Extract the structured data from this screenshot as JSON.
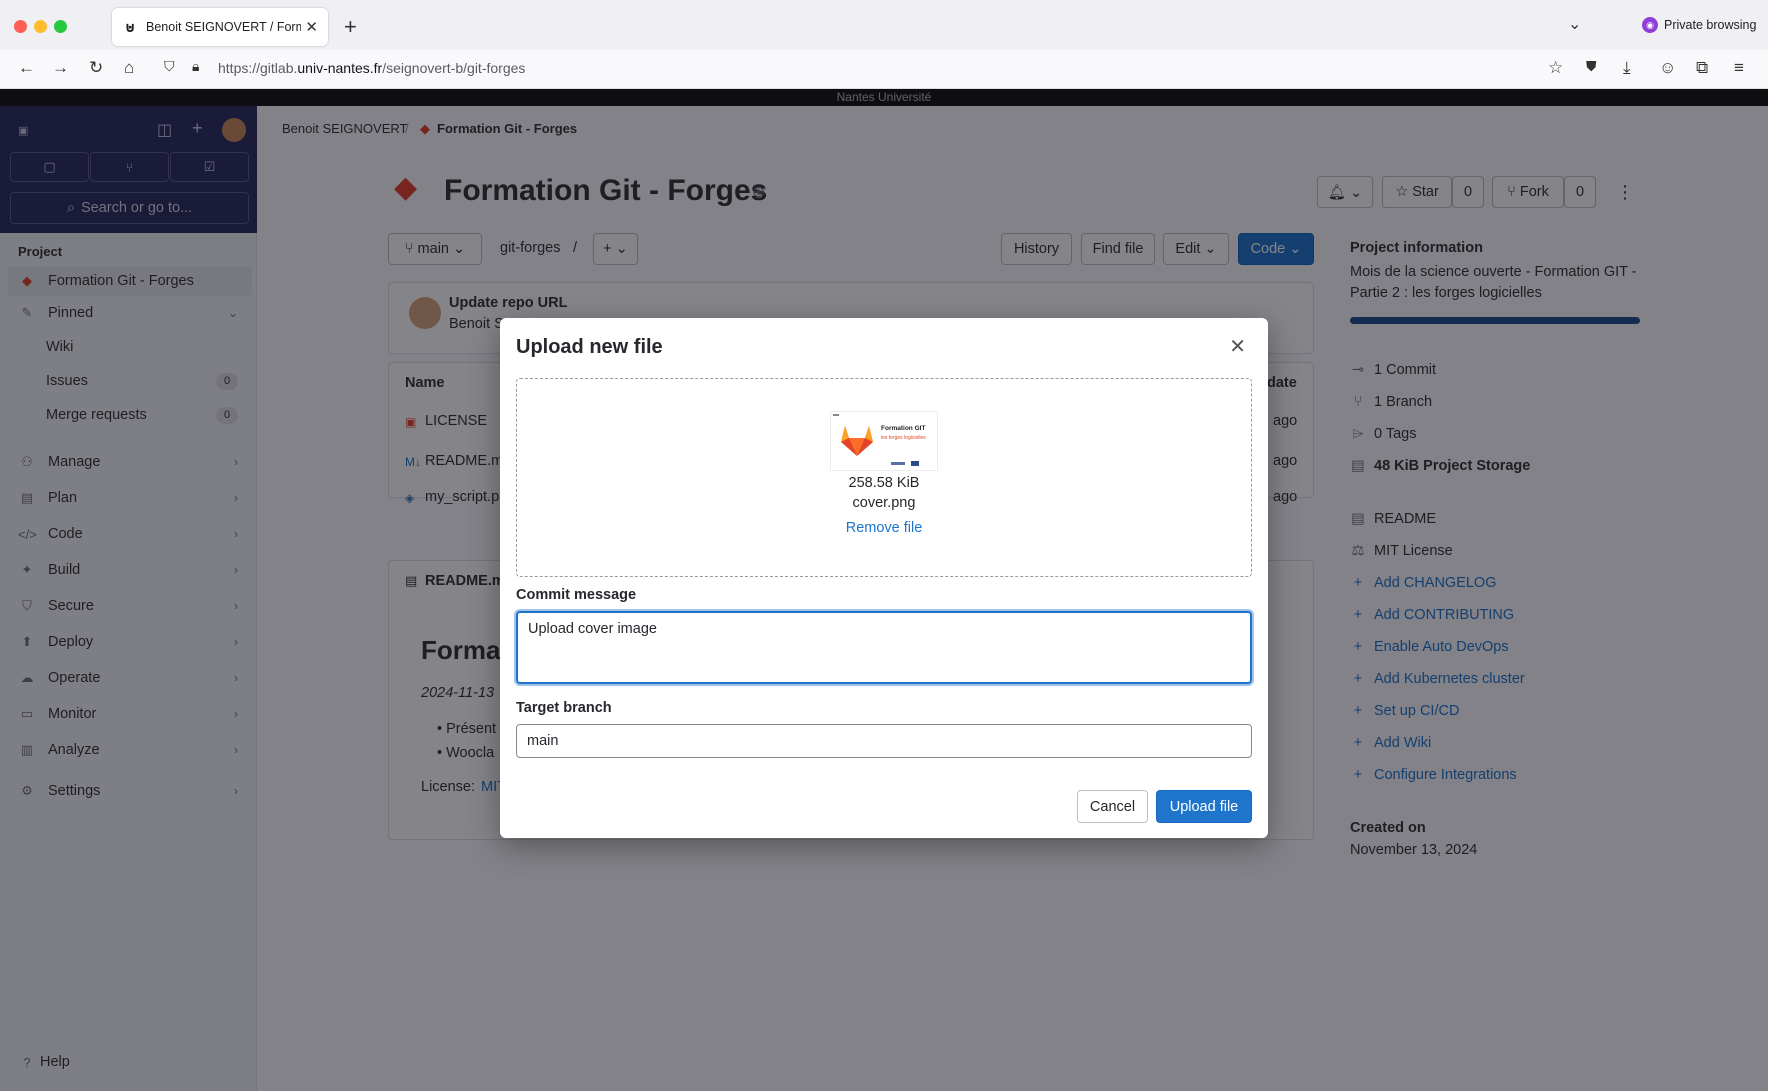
{
  "browser": {
    "tab_title": "Benoit SEIGNOVERT / Formation",
    "url_prefix": "https://gitlab.",
    "url_domain": "univ-nantes.fr",
    "url_path": "/seignovert-b/git-forges",
    "private_label": "Private browsing"
  },
  "banner": "Nantes Université",
  "sidebar": {
    "search": "Search or go to...",
    "section": "Project",
    "project_name": "Formation Git - Forges",
    "pinned": "Pinned",
    "pinned_items": [
      {
        "label": "Wiki"
      },
      {
        "label": "Issues",
        "count": "0"
      },
      {
        "label": "Merge requests",
        "count": "0"
      }
    ],
    "menu": [
      "Manage",
      "Plan",
      "Code",
      "Build",
      "Secure",
      "Deploy",
      "Operate",
      "Monitor",
      "Analyze",
      "Settings"
    ],
    "help": "Help"
  },
  "page": {
    "breadcrumb_user": "Benoit SEIGNOVERT",
    "breadcrumb_project": "Formation Git - Forges",
    "title": "Formation Git - Forges",
    "star": "Star",
    "star_count": "0",
    "fork": "Fork",
    "fork_count": "0",
    "branch": "main",
    "path": "git-forges",
    "path_sep": "/",
    "history": "History",
    "find_file": "Find file",
    "edit": "Edit",
    "code": "Code",
    "commit_title": "Update repo URL",
    "commit_author": "Benoit S",
    "files_header": "Name",
    "files_header_right": "date",
    "files": [
      "LICENSE",
      "README.m",
      "my_script.p"
    ],
    "file_time": "ago",
    "readme_tab": "README.m",
    "readme_heading": "Format",
    "readme_date": "2024-11-13",
    "readme_bullets": [
      "Présent",
      "Woocla"
    ],
    "license_label": "License:",
    "license_link": "MIT"
  },
  "project_info": {
    "heading": "Project information",
    "description": "Mois de la science ouverte - Formation GIT - Partie 2 : les forges logicielles",
    "stats": [
      "1 Commit",
      "1 Branch",
      "0 Tags",
      "48 KiB Project Storage"
    ],
    "links_plain": [
      "README",
      "MIT License"
    ],
    "links_add": [
      "Add CHANGELOG",
      "Add CONTRIBUTING",
      "Enable Auto DevOps",
      "Add Kubernetes cluster",
      "Set up CI/CD",
      "Add Wiki",
      "Configure Integrations"
    ],
    "created_label": "Created on",
    "created_date": "November 13, 2024"
  },
  "modal": {
    "title": "Upload new file",
    "file_size": "258.58 KiB",
    "file_name": "cover.png",
    "remove_file": "Remove file",
    "thumb_title": "Formation GIT",
    "thumb_subtitle": "les forges logicielles",
    "commit_label": "Commit message",
    "commit_value": "Upload cover image",
    "branch_label": "Target branch",
    "branch_value": "main",
    "cancel": "Cancel",
    "upload": "Upload file"
  },
  "colors": {
    "accent": "#1f75cb",
    "sidebar_top": "#2b2a5e",
    "gitlab_orange": "#e24329"
  }
}
